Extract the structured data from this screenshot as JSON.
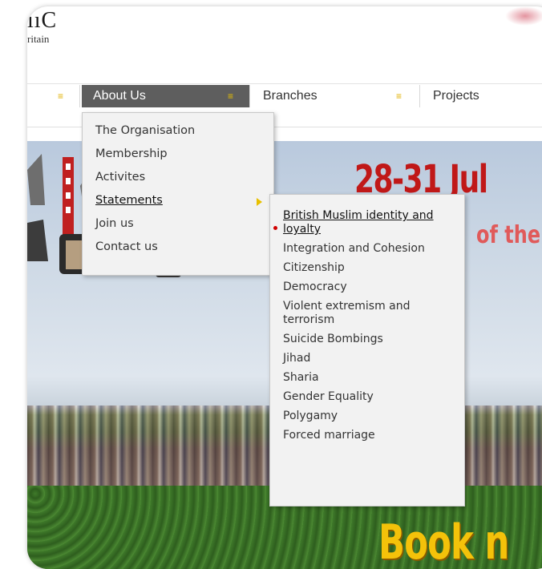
{
  "logo": {
    "text": "ııC",
    "subtext": "ritain"
  },
  "nav": {
    "items": [
      {
        "label": ""
      },
      {
        "label": "About Us"
      },
      {
        "label": "Branches"
      },
      {
        "label": "Projects"
      }
    ],
    "active_bg": "#5e5e5e",
    "chevron": "chevron-down-icon"
  },
  "about_menu": {
    "items": [
      {
        "label": "The Organisation"
      },
      {
        "label": "Membership"
      },
      {
        "label": "Activites"
      },
      {
        "label": "Statements"
      },
      {
        "label": "Join us"
      },
      {
        "label": "Contact us"
      }
    ],
    "active_item": "Statements"
  },
  "statements_menu": {
    "items": [
      {
        "label": "British Muslim identity and loyalty"
      },
      {
        "label": "Integration and Cohesion"
      },
      {
        "label": "Citizenship"
      },
      {
        "label": "Democracy"
      },
      {
        "label": "Violent extremism and terrorism"
      },
      {
        "label": "Suicide Bombings"
      },
      {
        "label": "Jihad"
      },
      {
        "label": "Sharia"
      },
      {
        "label": "Gender Equality"
      },
      {
        "label": "Polygamy"
      },
      {
        "label": "Forced marriage"
      }
    ],
    "hover_item": "British Muslim identity and loyalty"
  },
  "banner": {
    "title": "28-31 Jul",
    "subtitle": "of the Y",
    "cta": "Book n"
  },
  "colors": {
    "accent_yellow": "#e8c000",
    "banner_red": "#c01818",
    "cta_yellow": "#f4c20a"
  }
}
